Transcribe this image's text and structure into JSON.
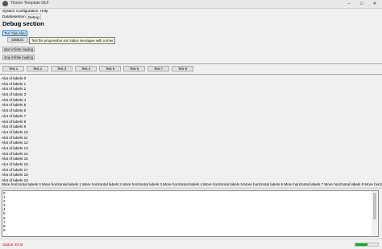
{
  "window": {
    "title": "Tkinter Template GUI"
  },
  "menu": [
    "System",
    "Configuration",
    "Help"
  ],
  "tabs": [
    "Database",
    "Json",
    "Debug"
  ],
  "section_title": "Debug section",
  "buttons": {
    "test_statusbar": "Test Statusbar",
    "debug": "DEBUG",
    "start_loading": "start infinite loading",
    "stop_loading": "stop infinite loading"
  },
  "tooltip": "Test the progressbar and status messages with a timer",
  "test_buttons": [
    "Test 1",
    "Test 2",
    "Test 3",
    "Test 4",
    "Test 5",
    "Test 6",
    "Test 7",
    "Test 8"
  ],
  "labels": [
    "Alot of labels 0",
    "Alot of labels 1",
    "Alot of labels 2",
    "Alot of labels 3",
    "Alot of labels 4",
    "Alot of labels 5",
    "Alot of labels 6",
    "Alot of labels 7",
    "Alot of labels 8",
    "Alot of labels 9",
    "Alot of labels 10",
    "Alot of labels 11",
    "Alot of labels 12",
    "Alot of labels 13",
    "Alot of labels 14",
    "Alot of labels 15",
    "Alot of labels 16",
    "Alot of labels 17",
    "Alot of labels 18",
    "Alot of labels 19"
  ],
  "horizontal_labels": "More horizontal labels 0 More horizontal labels 1 More horizontal labels 2 More horizontal labels 3 More horizontal labels 4 More horizontal labels 5 More horizontal labels 6 More horizontal labels 7 More horizontal labels 8 More horizontal labels 9",
  "output_lines": [
    "0",
    "1",
    "2",
    "3",
    "4",
    "5",
    "6",
    "7",
    "8",
    "9"
  ],
  "status": {
    "text": "Status: Error",
    "color": "#e00000",
    "progress": 0.55
  }
}
